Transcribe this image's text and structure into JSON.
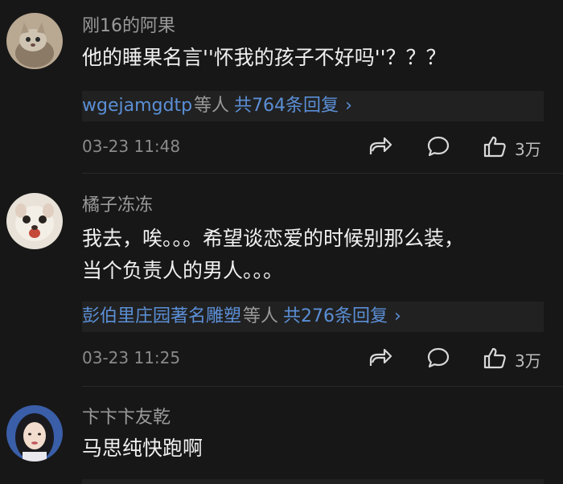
{
  "comments": [
    {
      "username": "刚16的阿果",
      "text_lines": [
        "他的睡果名言''怀我的孩子不好吗''？？？"
      ],
      "reply_users": "wgejamgdtp",
      "reply_etc": "等人",
      "reply_count": "共764条回复",
      "reply_chevron": "›",
      "timestamp": "03-23 11:48",
      "likes": "3万",
      "avatar_icon": "cat-avatar"
    },
    {
      "username": "橘子冻冻",
      "text_lines": [
        "我去，唉。。。希望谈恋爱的时候别那么装，",
        "当个负责人的男人。。。"
      ],
      "reply_users": "彭伯里庄园著名雕塑",
      "reply_etc": "等人",
      "reply_count": "共276条回复",
      "reply_chevron": "›",
      "timestamp": "03-23 11:25",
      "likes": "3万",
      "avatar_icon": "dog-avatar"
    },
    {
      "username": "卞卞卞友乾",
      "text_lines": [
        "马思纯快跑啊"
      ],
      "avatar_icon": "woman-avatar"
    }
  ],
  "colors": {
    "background": "#171717",
    "link": "#5b8fd6",
    "muted": "#9a9a9a"
  }
}
